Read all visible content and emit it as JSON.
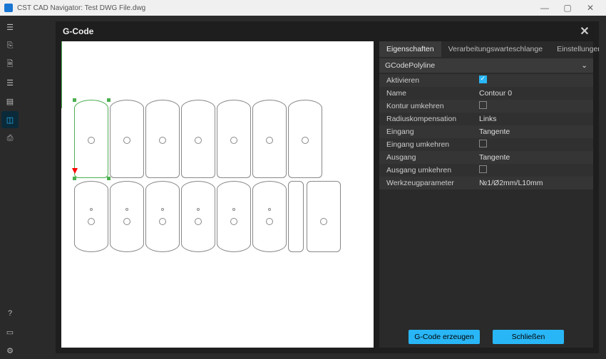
{
  "titlebar": {
    "text": "CST CAD Navigator: Test DWG File.dwg"
  },
  "modal": {
    "title": "G-Code"
  },
  "rail": {
    "items": [
      {
        "name": "menu-icon"
      },
      {
        "name": "export-icon"
      },
      {
        "name": "document-icon"
      },
      {
        "name": "list-icon"
      },
      {
        "name": "layers-icon"
      },
      {
        "name": "selection-icon",
        "active": true
      },
      {
        "name": "print-icon"
      }
    ],
    "bottom": [
      {
        "name": "help-icon"
      },
      {
        "name": "display-icon"
      },
      {
        "name": "settings-icon"
      }
    ]
  },
  "tabs": {
    "items": [
      {
        "label": "Eigenschaften",
        "active": true
      },
      {
        "label": "Verarbeitungswarteschlange",
        "active": false
      },
      {
        "label": "Einstellungen",
        "active": false
      }
    ]
  },
  "selector": {
    "value": "GCodePolyline"
  },
  "properties": [
    {
      "label": "Aktivieren",
      "type": "check",
      "checked": true
    },
    {
      "label": "Name",
      "type": "text",
      "value": "Contour 0"
    },
    {
      "label": "Kontur umkehren",
      "type": "check",
      "checked": false
    },
    {
      "label": "Radiuskompensation",
      "type": "text",
      "value": "Links"
    },
    {
      "label": "Eingang",
      "type": "text",
      "value": "Tangente"
    },
    {
      "label": "Eingang umkehren",
      "type": "check",
      "checked": false
    },
    {
      "label": "Ausgang",
      "type": "text",
      "value": "Tangente"
    },
    {
      "label": "Ausgang umkehren",
      "type": "check",
      "checked": false
    },
    {
      "label": "Werkzeugparameter",
      "type": "text",
      "value": "№1/Ø2mm/L10mm"
    }
  ],
  "footer": {
    "generate": "G-Code erzeugen",
    "close": "Schließen"
  }
}
